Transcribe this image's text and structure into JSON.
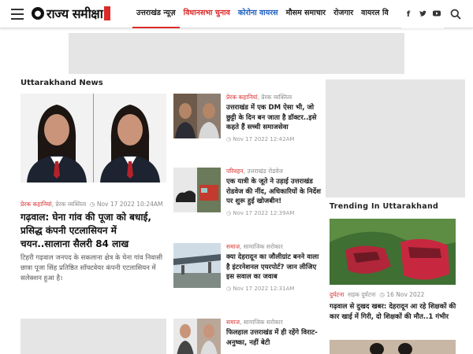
{
  "header": {
    "logo_text": "राज्य समीक्षा",
    "nav": [
      {
        "label": "उत्तराखंड न्यूज़",
        "color": "#222222",
        "active": true
      },
      {
        "label": "विधानसभा चुनाव",
        "color": "#d92b2b",
        "active": false
      },
      {
        "label": "कोरोना वायरस",
        "color": "#1f5fbf",
        "active": false
      },
      {
        "label": "मौसम समाचार",
        "color": "#222222",
        "active": false
      },
      {
        "label": "रोजगार",
        "color": "#222222",
        "active": false
      },
      {
        "label": "वायरल वि",
        "color": "#222222",
        "active": false
      }
    ],
    "social": [
      "f",
      "twitter",
      "youtube"
    ]
  },
  "section_title": "Uttarakhand News",
  "featured": {
    "category_1": "प्रेरक कहानियां",
    "category_2": "प्रेरक व्यक्तित्व",
    "date": "Nov 17 2022 10:24AM",
    "title": "गढ़वाल: घेना गांव की पूजा को बधाई, प्रसिद्ध कंपनी एटलासियन में चयन..सालाना सैलरी 84 लाख",
    "excerpt": "टिहरी गढ़वाल जनपद के सकलाना क्षेत्र के घेना गांव निवासी छात्रा पूजा सिंह प्रतिष्ठित सॉफ्टवेयर कंपनी एटलासियन में सलेक्शन हुआ है।"
  },
  "mid_items": [
    {
      "cat1": "प्रेरक कहानियां",
      "cat2": "प्रेरक व्यक्तित्व",
      "title": "उत्तराखंड में एक DM ऐसा भी, जो छुट्टी के दिन बन जाता है डॉक्टर..इसे कहते हैं सच्ची समाजसेवा",
      "date": "Nov 17 2022 12:42AM"
    },
    {
      "cat1": "परिवहन",
      "cat2": "उत्तराखंड रोडवेज",
      "title": "एक यात्री के जूते ने उड़ाई उत्तराखंड रोडवेज की नींद, अधिकारियों के निर्देश पर शुरू हुई खोजबीन!",
      "date": "Nov 17 2022 12:39AM"
    },
    {
      "cat1": "समाज",
      "cat2": "सामाजिक सरोकार",
      "title": "क्या देहरादून का जौलीग्रांट बनने वाला है इंटरनेशनल एयरपोर्ट? जान लीजिए इस सवाल का जवाब",
      "date": "Nov 17 2022 12:31AM"
    },
    {
      "cat1": "समाज",
      "cat2": "सामाजिक सरोकार",
      "title": "फिलहाल उत्तराखंड में ही रहेंगे विराट-अनुष्का, नहीं बेटी",
      "date": ""
    }
  ],
  "trending": {
    "title": "Trending In Uttarakhand",
    "cat1": "दुर्घटना",
    "cat2": "सड़क दुर्घटना",
    "date": "16 Nov 2022",
    "headline": "गढ़वाल से दुखद खबर: देहरादून आ रहे शिक्षकों की कार खाई में गिरी, दो शिक्षकों की मौत..1 गंभीर"
  }
}
